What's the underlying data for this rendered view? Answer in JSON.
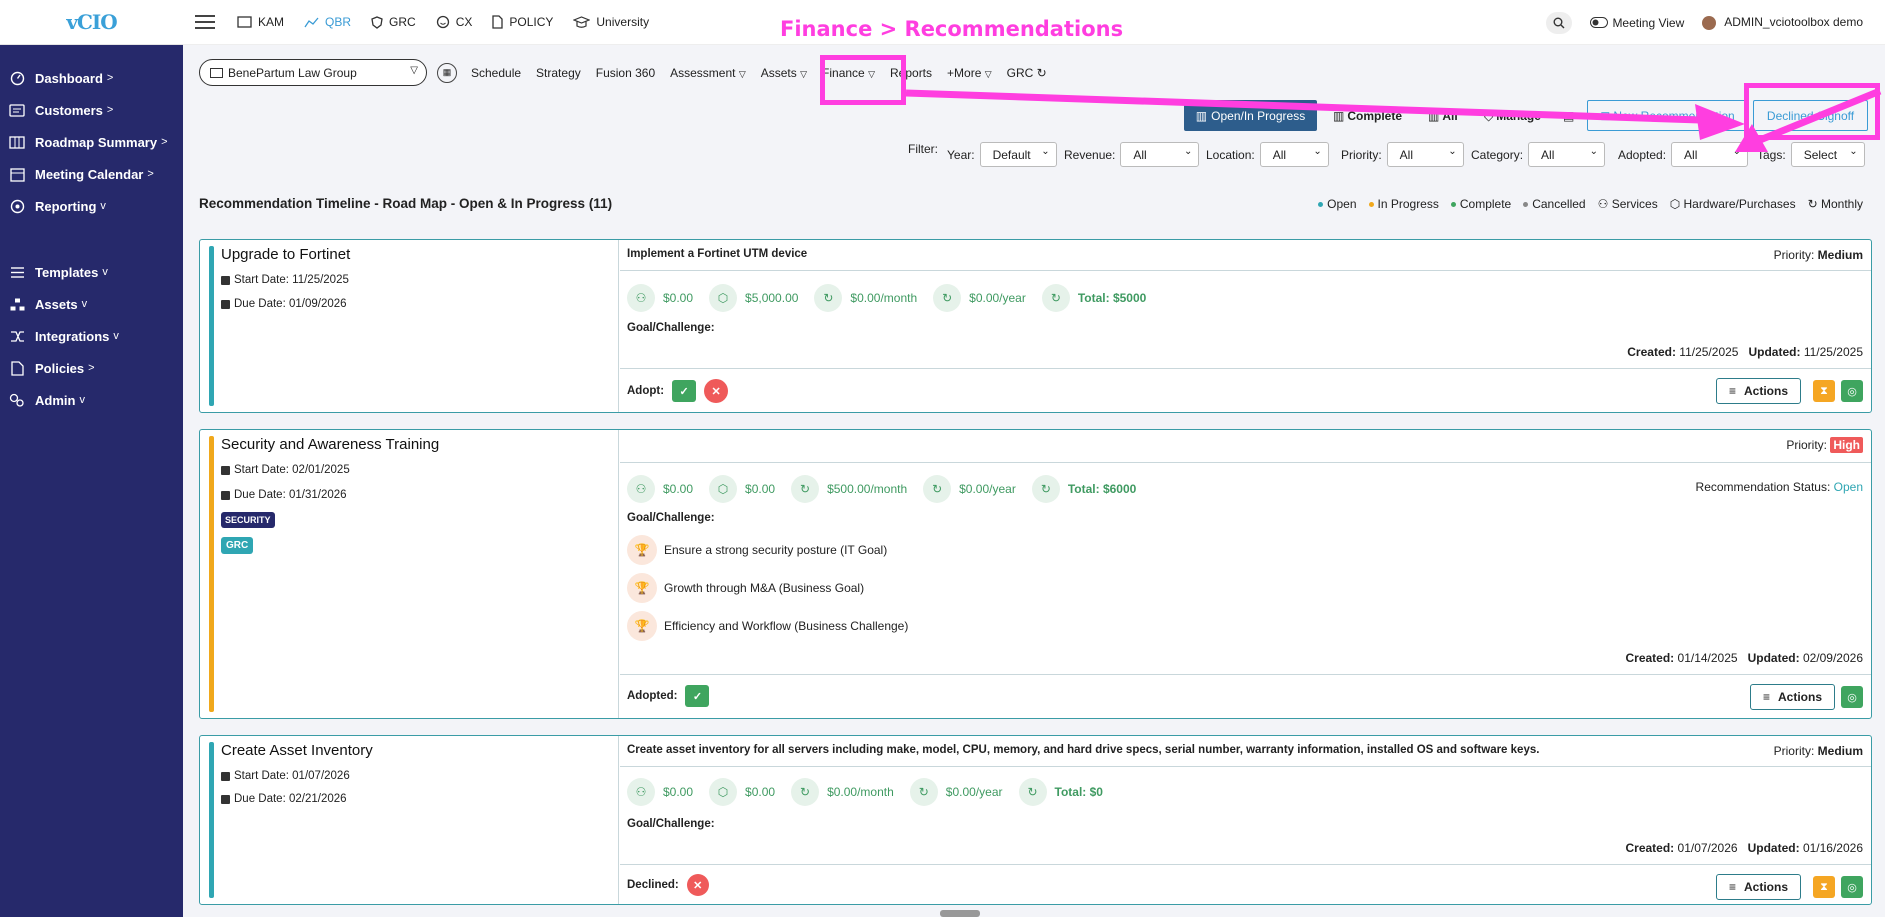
{
  "app": {
    "logo": "vCIO"
  },
  "sidebar": {
    "items": [
      {
        "label": "Dashboard",
        "chev": ">"
      },
      {
        "label": "Customers",
        "chev": ">"
      },
      {
        "label": "Roadmap Summary",
        "chev": ">"
      },
      {
        "label": "Meeting Calendar",
        "chev": ">"
      },
      {
        "label": "Reporting",
        "chev": "v"
      },
      {
        "label": "Templates",
        "chev": "v"
      },
      {
        "label": "Assets",
        "chev": "v"
      },
      {
        "label": "Integrations",
        "chev": "v"
      },
      {
        "label": "Policies",
        "chev": ">"
      },
      {
        "label": "Admin",
        "chev": "v"
      }
    ]
  },
  "topnav": {
    "items": [
      "KAM",
      "QBR",
      "GRC",
      "CX",
      "POLICY",
      "University"
    ],
    "active": "QBR",
    "meeting_view": "Meeting View",
    "user": "ADMIN_vciotoolbox demo"
  },
  "annotation": {
    "title": "Finance > Recommendations"
  },
  "subnav": {
    "client": "BenePartum Law Group",
    "items": [
      "Schedule",
      "Strategy",
      "Fusion 360",
      "Assessment",
      "Assets",
      "Finance",
      "Reports",
      "+More",
      "GRC"
    ]
  },
  "toolbar": {
    "open_in_progress": "Open/In Progress",
    "complete": "Complete",
    "all": "All",
    "manage": "Manage",
    "new_recommendation": "New Recommendation",
    "declined_signoff": "Declined Signoff"
  },
  "filters": {
    "label": "Filter:",
    "year": {
      "label": "Year:",
      "value": "Default"
    },
    "revenue": {
      "label": "Revenue:",
      "value": "All"
    },
    "location": {
      "label": "Location:",
      "value": "All"
    },
    "priority": {
      "label": "Priority:",
      "value": "All"
    },
    "category": {
      "label": "Category:",
      "value": "All"
    },
    "adopted": {
      "label": "Adopted:",
      "value": "All"
    },
    "tags": {
      "label": "Tags:",
      "value": "Select"
    }
  },
  "section": {
    "title": "Recommendation Timeline - Road Map - Open & In Progress (11)",
    "legend": [
      "Open",
      "In Progress",
      "Complete",
      "Cancelled",
      "Services",
      "Hardware/Purchases",
      "Monthly"
    ]
  },
  "colors": {
    "open": "#2fa6b3",
    "in_progress": "#f0a81c",
    "complete": "#3fa55f",
    "cancelled": "#888888",
    "brand": "#26296b",
    "highlight": "#ff3ee0"
  },
  "cards": [
    {
      "title": "Upgrade to Fortinet",
      "start": "Start Date: 11/25/2025",
      "due": "Due Date: 01/09/2026",
      "desc": "Implement a Fortinet UTM device",
      "priority_label": "Priority:",
      "priority": "Medium",
      "costs": [
        "$0.00",
        "$5,000.00",
        "$0.00/month",
        "$0.00/year",
        "Total: $5000"
      ],
      "goal": "Goal/Challenge:",
      "created_label": "Created:",
      "created": "11/25/2025",
      "updated_label": "Updated:",
      "updated": "11/25/2025",
      "adopt": "Adopt:",
      "actions": "Actions"
    },
    {
      "title": "Security and Awareness Training",
      "start": "Start Date: 02/01/2025",
      "due": "Due Date: 01/31/2026",
      "badges": [
        "SECURITY",
        "GRC"
      ],
      "priority_label": "Priority:",
      "priority": "High",
      "costs": [
        "$0.00",
        "$0.00",
        "$500.00/month",
        "$0.00/year",
        "Total: $6000"
      ],
      "status_label": "Recommendation Status:",
      "status": "Open",
      "goal": "Goal/Challenge:",
      "goals": [
        "Ensure a strong security posture (IT Goal)",
        "Growth through M&A (Business Goal)",
        "Efficiency and Workflow (Business Challenge)"
      ],
      "created_label": "Created:",
      "created": "01/14/2025",
      "updated_label": "Updated:",
      "updated": "02/09/2026",
      "adopt": "Adopted:",
      "actions": "Actions"
    },
    {
      "title": "Create Asset Inventory",
      "start": "Start Date: 01/07/2026",
      "due": "Due Date: 02/21/2026",
      "desc": "Create asset inventory for all servers including make, model, CPU, memory, and hard drive specs, serial number, warranty information, installed OS and software keys.",
      "priority_label": "Priority:",
      "priority": "Medium",
      "costs": [
        "$0.00",
        "$0.00",
        "$0.00/month",
        "$0.00/year",
        "Total: $0"
      ],
      "goal": "Goal/Challenge:",
      "created_label": "Created:",
      "created": "01/07/2026",
      "updated_label": "Updated:",
      "updated": "01/16/2026",
      "adopt": "Declined:",
      "actions": "Actions"
    }
  ]
}
